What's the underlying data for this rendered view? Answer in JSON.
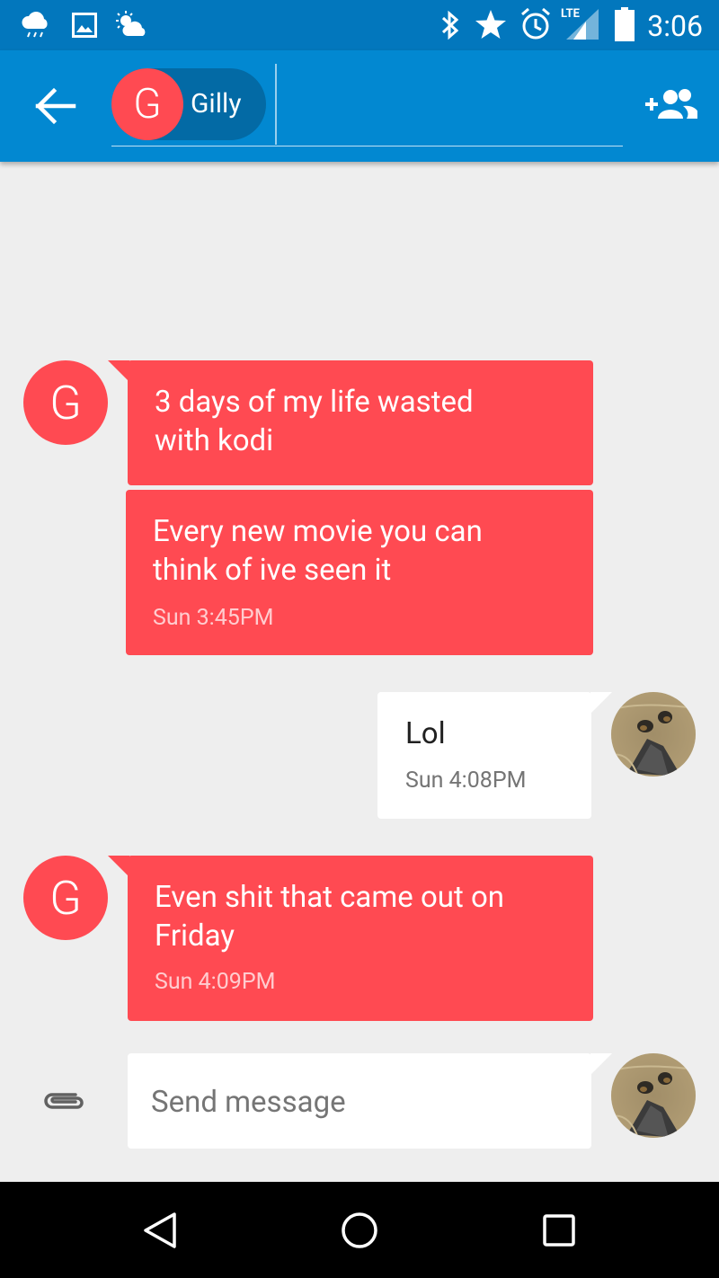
{
  "status_bar": {
    "time": "3:06",
    "network_label": "LTE",
    "icons": [
      "rain-cloud-icon",
      "image-icon",
      "partly-sunny-icon",
      "bluetooth-icon",
      "star-icon",
      "alarm-icon",
      "lte-signal-icon",
      "battery-icon"
    ]
  },
  "app_bar": {
    "recipient_initial": "G",
    "recipient_name": "Gilly",
    "icons": [
      "back-arrow-icon",
      "add-person-icon"
    ]
  },
  "messages": [
    {
      "sender": "Gilly",
      "direction": "incoming",
      "avatar_initial": "G",
      "text": [
        "3 days of my life wasted",
        "with kodi"
      ]
    },
    {
      "sender": "Gilly",
      "direction": "incoming",
      "text": [
        "Every new movie you can",
        "think of ive seen it"
      ],
      "time": "Sun 3:45PM"
    },
    {
      "sender": "me",
      "direction": "outgoing",
      "text": [
        "Lol"
      ],
      "time": "Sun 4:08PM"
    },
    {
      "sender": "Gilly",
      "direction": "incoming",
      "avatar_initial": "G",
      "text": [
        "Even shit that came out on",
        "Friday"
      ],
      "time": "Sun 4:09PM"
    }
  ],
  "compose": {
    "placeholder": "Send message",
    "attach_icon": "paperclip-icon"
  },
  "colors": {
    "status_bar": "#0277bd",
    "app_bar": "#0288d1",
    "incoming_bubble": "#ff4a52",
    "outgoing_bubble": "#ffffff",
    "background": "#eeeeee"
  }
}
